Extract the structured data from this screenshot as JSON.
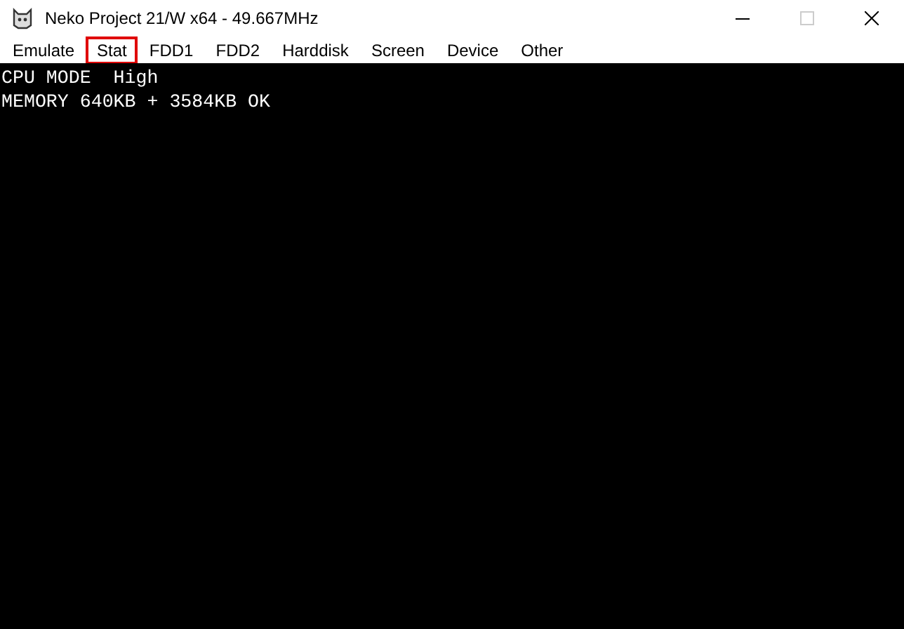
{
  "window": {
    "title": "Neko Project 21/W x64 - 49.667MHz",
    "maximize_disabled": true
  },
  "menu": [
    {
      "label": "Emulate",
      "highlighted": false
    },
    {
      "label": "Stat",
      "highlighted": true
    },
    {
      "label": "FDD1",
      "highlighted": false
    },
    {
      "label": "FDD2",
      "highlighted": false
    },
    {
      "label": "Harddisk",
      "highlighted": false
    },
    {
      "label": "Screen",
      "highlighted": false
    },
    {
      "label": "Device",
      "highlighted": false
    },
    {
      "label": "Other",
      "highlighted": false
    }
  ],
  "screen": {
    "lines": [
      "CPU MODE  High",
      "MEMORY 640KB + 3584KB OK"
    ]
  }
}
